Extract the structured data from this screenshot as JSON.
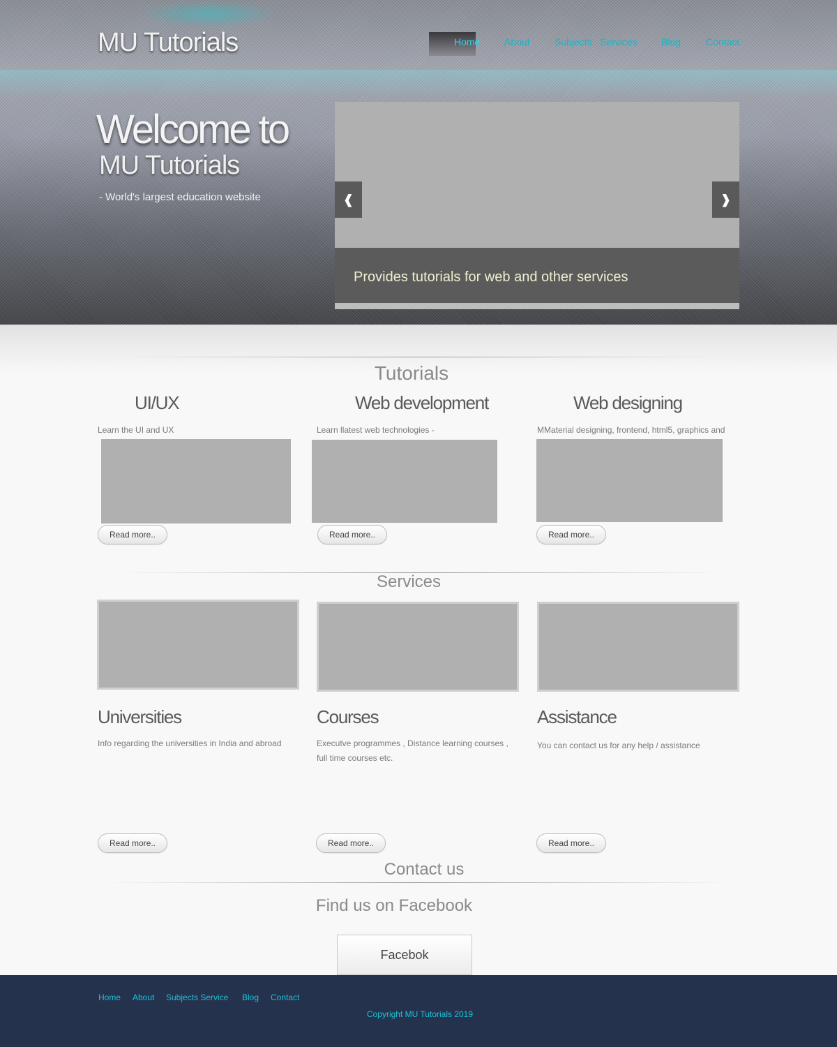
{
  "header": {
    "logo": "MU Tutorials",
    "nav": [
      "Home",
      "About",
      "Subjects",
      "Services",
      "Blog",
      "Contact"
    ]
  },
  "hero": {
    "welcome": "Welcome to",
    "brand": "MU Tutorials",
    "tagline": "- World's largest education website",
    "slider": {
      "caption": "Provides tutorials for web and other services",
      "prev_icon": "❰",
      "next_icon": "❱"
    }
  },
  "tutorials": {
    "title": "Tutorials",
    "items": [
      {
        "title": "UI/UX",
        "text": "Learn the UI and UX",
        "button": "Read more.."
      },
      {
        "title": "Web development",
        "text": "Learn llatest web technologies -",
        "button": "Read more.."
      },
      {
        "title": "Web designing",
        "text": "MMaterial designing, frontend, html5, graphics and",
        "button": "Read more.."
      }
    ]
  },
  "services": {
    "title": "Services",
    "items": [
      {
        "title": "Universities",
        "text": "Info regarding the universities in India and abroad",
        "button": "Read more.."
      },
      {
        "title": "Courses",
        "text": "Executve programmes , Distance learning courses , full time courses etc.",
        "button": "Read more.."
      },
      {
        "title": "Assistance",
        "text": "You can contact us for any help / assistance",
        "button": "Read more.."
      }
    ]
  },
  "contact": {
    "title": "Contact us",
    "facebook_heading": "Find us on Facebook",
    "facebook_button": "Facebok"
  },
  "footer": {
    "links": [
      "Home",
      "About",
      "Subjects Service",
      "Blog",
      "Contact"
    ],
    "copyright": "Copyright MU Tutorials 2019"
  },
  "colors": {
    "accent": "#19b4c8",
    "footer_bg": "#24324d",
    "caption_text": "#f0eecf"
  }
}
